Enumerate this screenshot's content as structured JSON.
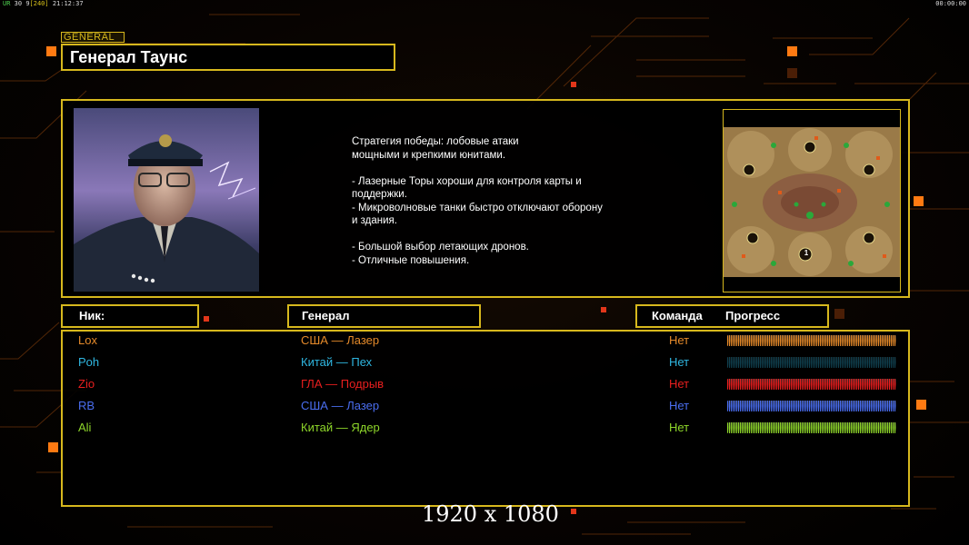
{
  "hud": {
    "top_left_prefix": "UR",
    "top_left_fps": "30",
    "top_left_mid": "9",
    "top_left_bracket": "[240]",
    "top_left_time": "21:12:37",
    "top_right_time": "00:00:00"
  },
  "general": {
    "tag": "GENERAL",
    "name": "Генерал Таунс"
  },
  "description": "Стратегия победы: лобовые атаки\nмощными и крепкими юнитами.\n\n- Лазерные Торы хороши для контроля карты и\n поддержки.\n- Микроволновые танки быстро отключают оборону\n и здания.\n\n- Большой выбор летающих дронов.\n- Отличные повышения.",
  "columns": {
    "nick": "Ник:",
    "general": "Генерал",
    "team": "Команда",
    "progress": "Прогресс"
  },
  "players": [
    {
      "nick": "Lox",
      "general": "США — Лазер",
      "team": "Нет",
      "color": "#e58a2a",
      "progress": 1.0
    },
    {
      "nick": "Poh",
      "general": "Китай — Пех",
      "team": "Нет",
      "color": "#2fb6e0",
      "progress": 1.0
    },
    {
      "nick": "Zio",
      "general": "ГЛА — Подрыв",
      "team": "Нет",
      "color": "#e81f1f",
      "progress": 1.0
    },
    {
      "nick": "RB",
      "general": "США — Лазер",
      "team": "Нет",
      "color": "#4a6ef0",
      "progress": 1.0
    },
    {
      "nick": "Ali",
      "general": "Китай — Ядер",
      "team": "Нет",
      "color": "#8ed62a",
      "progress": 1.0
    }
  ],
  "minimap": {
    "start_marker": "1"
  },
  "overlay": {
    "resolution": "1920 x 1080"
  },
  "colors": {
    "accent": "#d7b81d",
    "highlight": "#ff8a1a"
  }
}
